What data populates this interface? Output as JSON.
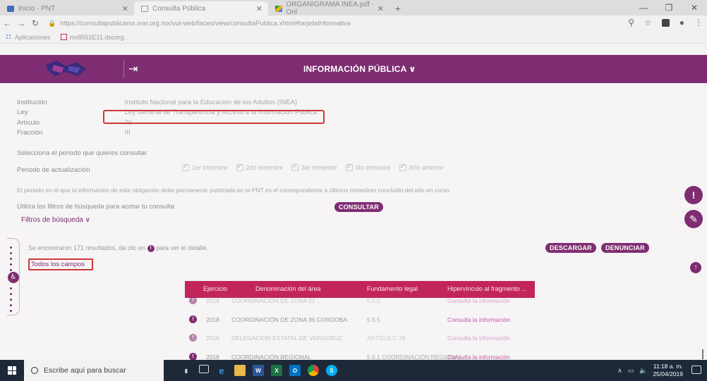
{
  "browser": {
    "tabs": [
      {
        "label": "Inicio · PNT"
      },
      {
        "label": "Consulta Pública"
      },
      {
        "label": "ORGANIGRAMA INEA.pdf - Onl"
      }
    ],
    "url": "https://consultapublicamx.inai.org.mx/vut-web/faces/view/consultaPublica.xhtml#tarjetaInformativa",
    "bookmarks": [
      {
        "label": "Aplicaciones"
      },
      {
        "label": "mx8551E11.dscorg..."
      }
    ]
  },
  "site": {
    "title": "INFORMACIÓN PÚBLICA ∨"
  },
  "fields": [
    {
      "label": "Institución",
      "value": "Instituto Nacional para la Educación de los Adultos (INEA)"
    },
    {
      "label": "Ley",
      "value": "Ley General de Transparencia y Acceso a la Información Pública"
    },
    {
      "label": "Artículo",
      "value": "70"
    },
    {
      "label": "Fracción",
      "value": "III"
    }
  ],
  "instructions": {
    "select_period": "Selecciona el periodo que quieres consultar",
    "period_label": "Periodo de actualización",
    "periods": [
      "1er trimestre",
      "2do trimestre",
      "3er trimestre",
      "4to trimestre",
      "Año anterior"
    ],
    "notice": "El periodo en el que la información de esta obligación debe permanecer publicada en la PNT es el correspondiente a últimos trimestres concluido del año en curso",
    "filters_hint": "Utiliza los filtros de búsqueda para acotar tu consulta",
    "consult_button": "CONSULTAR",
    "filters_toggle": "Filtros de búsqueda ∨"
  },
  "results": {
    "summary_prefix": "Se encontraron 171 resultados, da clic en",
    "summary_suffix": "para ver el detalle.",
    "download_button": "DESCARGAR",
    "report_button": "DENUNCIAR",
    "all_fields": "Todos los campos"
  },
  "table": {
    "headers": [
      "Ejercicio",
      "Denominación del área",
      "Fundamento legal",
      "Hipervínculo al fragmento ..."
    ],
    "rows": [
      {
        "year": "2018",
        "area": "COORDINACIÓN DE ZONA 22 ...",
        "legal": "5.5.5",
        "link": "Consulta la información",
        "faded": true
      },
      {
        "year": "2018",
        "area": "COORDINACIÓN DE ZONA 36 CORDOBA",
        "legal": "5.5.5",
        "link": "Consulta la información",
        "faded": false
      },
      {
        "year": "2018",
        "area": "DELEGACIÓN ESTATAL DE VERACRUZ",
        "legal": "ARTÍCULO 28",
        "link": "Consulta la información",
        "faded": true
      },
      {
        "year": "2018",
        "area": "COORDINACIÓN REGIONAL",
        "legal": "5.5.1 COORDINACIÓN REGIONAL",
        "link": "Consulta la información",
        "faded": false
      }
    ]
  },
  "taskbar": {
    "search_placeholder": "Escribe aquí para buscar",
    "time": "11:18 a. m.",
    "date": "25/04/2019"
  },
  "colors": {
    "brand": "#7e2d72",
    "table_header": "#c2255c",
    "annotation": "#cc3838"
  }
}
